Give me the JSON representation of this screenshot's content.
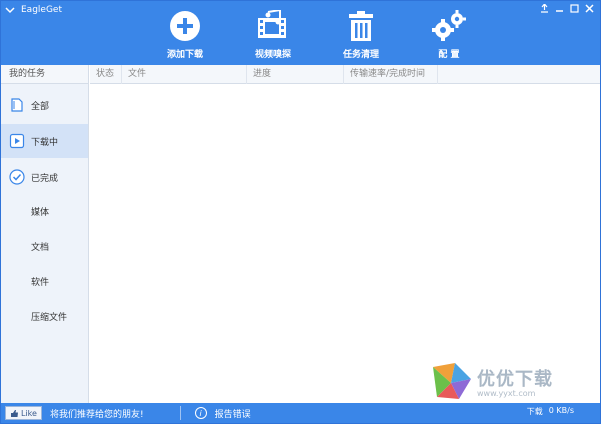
{
  "app": {
    "title": "EagleGet"
  },
  "toolbar": {
    "add_download": "添加下载",
    "video_sniff": "视频嗅探",
    "task_clean": "任务清理",
    "settings": "配 置"
  },
  "sidebar": {
    "header": "我的任务",
    "items": [
      {
        "label": "全部",
        "icon": "all-files-icon"
      },
      {
        "label": "下载中",
        "icon": "play-icon",
        "active": true
      },
      {
        "label": "已完成",
        "icon": "check-circle-icon"
      }
    ],
    "subitems": [
      "媒体",
      "文档",
      "软件",
      "压缩文件"
    ]
  },
  "columns": [
    "状态",
    "文件",
    "进度",
    "传输速率/完成时间"
  ],
  "statusbar": {
    "like": "Like",
    "recommend": "将我们推荐给您的朋友!",
    "report": "报告错误",
    "download_label": "下载",
    "speed": "0 KB/s"
  },
  "watermark": {
    "main": "优优下载",
    "sub": "www.yyxt.com"
  },
  "colors": {
    "primary": "#3a86e8",
    "sidebar_bg": "#eef3fa",
    "active_bg": "#d3e2f7"
  }
}
